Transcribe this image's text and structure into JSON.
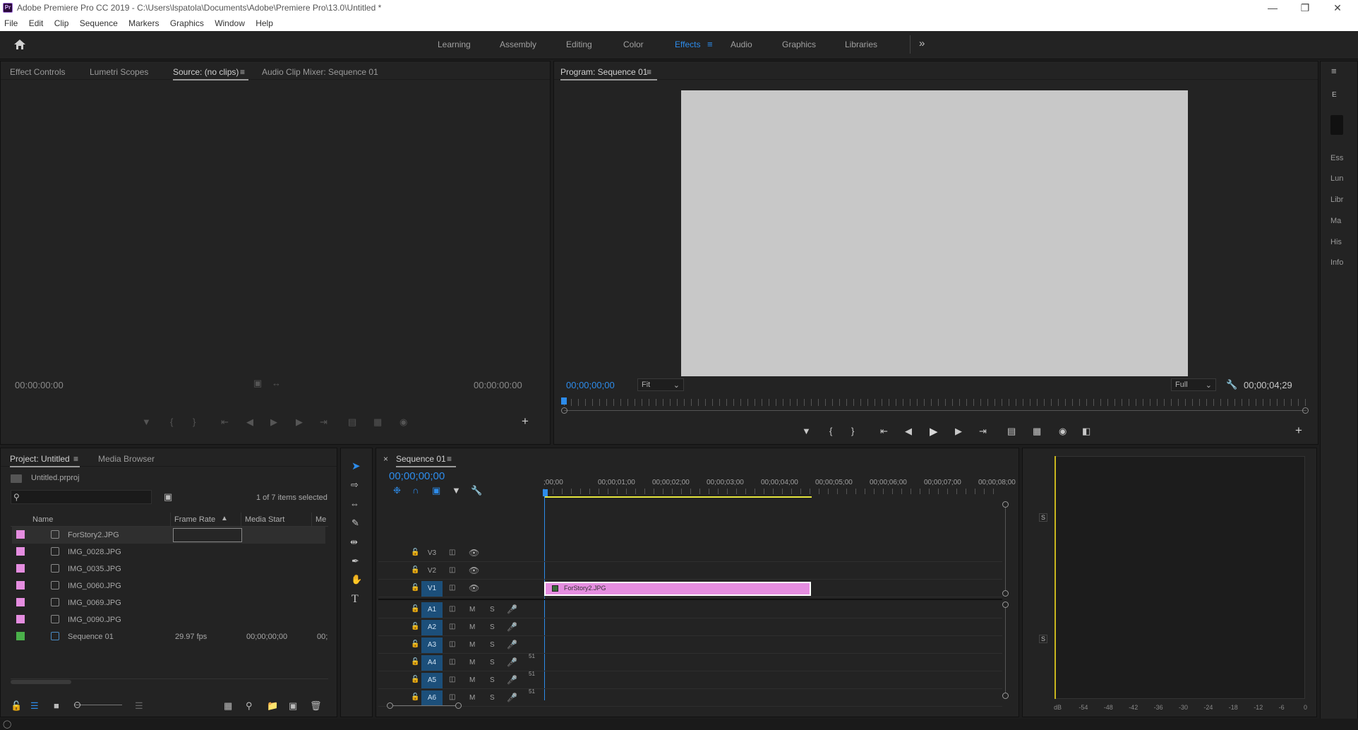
{
  "window": {
    "title": "Adobe Premiere Pro CC 2019 - C:\\Users\\lspatola\\Documents\\Adobe\\Premiere Pro\\13.0\\Untitled *",
    "app_badge": "Pr"
  },
  "menu": [
    "File",
    "Edit",
    "Clip",
    "Sequence",
    "Markers",
    "Graphics",
    "Window",
    "Help"
  ],
  "workspaces": {
    "items": [
      "Learning",
      "Assembly",
      "Editing",
      "Color",
      "Effects",
      "Audio",
      "Graphics",
      "Libraries"
    ],
    "active": "Effects",
    "overflow": "»"
  },
  "source_panel": {
    "tabs": [
      "Effect Controls",
      "Lumetri Scopes",
      "Source: (no clips)",
      "Audio Clip Mixer: Sequence 01"
    ],
    "timecode_left": "00:00:00:00",
    "timecode_right": "00:00:00:00"
  },
  "program_panel": {
    "title": "Program: Sequence 01",
    "timecode": "00;00;00;00",
    "zoom": "Fit",
    "resolution": "Full",
    "duration": "00;00;04;29",
    "colors": {
      "frame_bg": "#c8c8c8"
    }
  },
  "right_panel": {
    "items": [
      "Ess",
      "Lun",
      "Libr",
      "Ma",
      "His",
      "Info"
    ],
    "top_label": "E"
  },
  "project_panel": {
    "tabs": [
      "Project: Untitled",
      "Media Browser"
    ],
    "project_file": "Untitled.prproj",
    "selection_status": "1 of 7 items selected",
    "columns": [
      "Name",
      "Frame Rate",
      "Media Start",
      "Me"
    ],
    "items": [
      {
        "name": "ForStory2.JPG",
        "frame_rate": "",
        "media_start": "",
        "color": "#e58de0",
        "type": "image",
        "selected": true
      },
      {
        "name": "IMG_0028.JPG",
        "frame_rate": "",
        "media_start": "",
        "color": "#e58de0",
        "type": "image"
      },
      {
        "name": "IMG_0035.JPG",
        "frame_rate": "",
        "media_start": "",
        "color": "#e58de0",
        "type": "image"
      },
      {
        "name": "IMG_0060.JPG",
        "frame_rate": "",
        "media_start": "",
        "color": "#e58de0",
        "type": "image"
      },
      {
        "name": "IMG_0069.JPG",
        "frame_rate": "",
        "media_start": "",
        "color": "#e58de0",
        "type": "image"
      },
      {
        "name": "IMG_0090.JPG",
        "frame_rate": "",
        "media_start": "",
        "color": "#e58de0",
        "type": "image"
      },
      {
        "name": "Sequence 01",
        "frame_rate": "29.97 fps",
        "media_start": "00;00;00;00",
        "media_end": "00;",
        "color": "#4ab04a",
        "type": "sequence"
      }
    ]
  },
  "timeline": {
    "tab": "Sequence 01",
    "timecode": "00;00;00;00",
    "ruler": [
      ";00;00",
      "00;00;01;00",
      "00;00;02;00",
      "00;00;03;00",
      "00;00;04;00",
      "00;00;05;00",
      "00;00;06;00",
      "00;00;07;00",
      "00;00;08;00"
    ],
    "video_tracks": [
      "V3",
      "V2",
      "V1"
    ],
    "audio_tracks": [
      "A1",
      "A2",
      "A3",
      "A4",
      "A5",
      "A6"
    ],
    "clip": {
      "name": "ForStory2.JPG",
      "color": "#e58de0"
    },
    "mute": "M",
    "solo": "S",
    "audio_level": "51"
  },
  "audio_meter": {
    "scale": [
      "dB",
      "-54",
      "-48",
      "-42",
      "-36",
      "-30",
      "-24",
      "-18",
      "-12",
      "-6",
      "0"
    ],
    "solo_label": "S"
  }
}
